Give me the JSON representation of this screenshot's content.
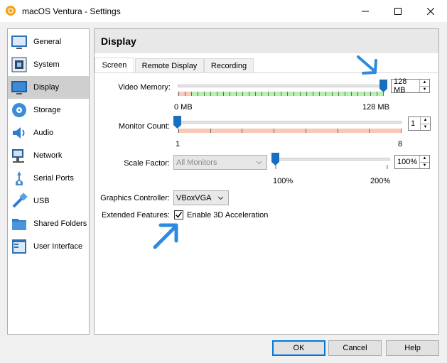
{
  "window": {
    "title": "macOS Ventura - Settings",
    "icons": {
      "app": "gear-app-icon",
      "minimize": "minimize-icon",
      "maximize": "maximize-icon",
      "close": "close-icon"
    }
  },
  "sidebar": {
    "items": [
      {
        "label": "General",
        "icon": "general-icon"
      },
      {
        "label": "System",
        "icon": "system-icon"
      },
      {
        "label": "Display",
        "icon": "display-icon",
        "selected": true
      },
      {
        "label": "Storage",
        "icon": "storage-icon"
      },
      {
        "label": "Audio",
        "icon": "audio-icon"
      },
      {
        "label": "Network",
        "icon": "network-icon"
      },
      {
        "label": "Serial Ports",
        "icon": "serial-ports-icon"
      },
      {
        "label": "USB",
        "icon": "usb-icon"
      },
      {
        "label": "Shared Folders",
        "icon": "shared-folders-icon"
      },
      {
        "label": "User Interface",
        "icon": "user-interface-icon"
      }
    ]
  },
  "content": {
    "title": "Display",
    "tabs": [
      {
        "label": "Screen",
        "active": true
      },
      {
        "label": "Remote Display"
      },
      {
        "label": "Recording"
      }
    ],
    "video_memory": {
      "label": "Video Memory:",
      "value": "128 MB",
      "min_label": "0 MB",
      "max_label": "128 MB",
      "level": 1.0
    },
    "monitor_count": {
      "label": "Monitor Count:",
      "value": "1",
      "min_label": "1",
      "max_label": "8",
      "level": 0.0
    },
    "scale_factor": {
      "label": "Scale Factor:",
      "monitor_select": "All Monitors",
      "value": "100%",
      "min_label": "100%",
      "max_label": "200%",
      "level": 0.0
    },
    "graphics_controller": {
      "label": "Graphics Controller:",
      "value": "VBoxVGA"
    },
    "extended_features": {
      "label": "Extended Features:",
      "checkbox_label": "Enable 3D Acceleration",
      "checked": true
    }
  },
  "buttons": {
    "ok": "OK",
    "cancel": "Cancel",
    "help": "Help"
  },
  "colors": {
    "accent": "#1a6ebf",
    "annotation_arrow": "#2b8be0",
    "range_good": "#b7f0b0",
    "range_warn": "#f7c9b8"
  }
}
